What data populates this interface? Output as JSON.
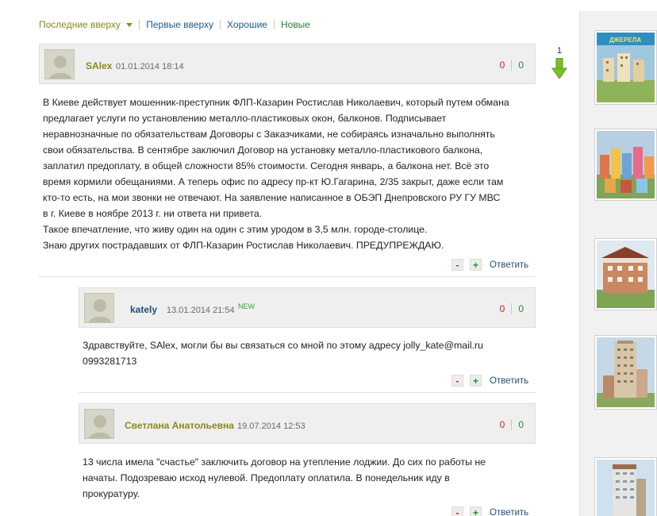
{
  "sort": {
    "options": [
      "Последние вверху",
      "Первые вверху",
      "Хорошие",
      "Новые"
    ]
  },
  "pagination": {
    "current_page": "1"
  },
  "comments": [
    {
      "author": "SAlex",
      "date": "01.01.2014 18:14",
      "votes_negative": "0",
      "votes_positive": "0",
      "lines": [
        "В Киеве действует мошенник-преступник ФЛП-Казарин Ростислав Николаевич, который путем обмана",
        "предлагает услуги по установлению металло-пластиковых окон, балконов. Подписывает",
        "неравнозначные по обязательствам Договоры с Заказчиками, не собираясь изначально выполнять",
        "свои обязательства. В сентябре заключил Договор на установку металло-пластикового балкона,",
        "заплатил предоплату, в общей сложности 85% стоимости. Сегодня январь, а балкона нет. Всё это",
        "время кормили обещаниями. А теперь офис по адресу пр-кт Ю.Гагарина, 2/35 закрыт, даже если там",
        "кто-то есть, на мои звонки не отвечают. На заявление написанное в ОБЭП Днепровского РУ ГУ МВС",
        "в г. Киеве в ноябре 2013 г. ни ответа ни привета.",
        "Такое впечатление, что живу один на один с этим уродом в 3,5 млн. городе-столице.",
        "Знаю других пострадавших от ФЛП-Казарин Ростислав Николаевич. ПРЕДУПРЕЖДАЮ."
      ],
      "minus_label": "-",
      "plus_label": "+",
      "reply_label": "Ответить"
    },
    {
      "author": "kately",
      "date": "13.01.2014 21:54",
      "badge": "NEW",
      "votes_negative": "0",
      "votes_positive": "0",
      "lines": [
        "Здравствуйте, SAlex, могли бы вы связаться со мной по этому адресу jolly_kate@mail.ru",
        "0993281713"
      ],
      "minus_label": "-",
      "plus_label": "+",
      "reply_label": "Ответить"
    },
    {
      "author": "Светлана Анатольевна",
      "date": "19.07.2014 12:53",
      "votes_negative": "0",
      "votes_positive": "0",
      "lines": [
        "13 числа имела \"счастье\" заключить договор на утепление лоджии. До сих по работы не",
        "начаты. Подозреваю исход нулевой. Предоплату оплатила. В понедельник иду в",
        "прокуратуру."
      ],
      "minus_label": "-",
      "plus_label": "+",
      "reply_label": "Ответить"
    }
  ],
  "sidebar": {
    "ads": [
      {
        "title": "ДЖЕРЕЛА"
      },
      {
        "title": ""
      },
      {
        "title": ""
      },
      {
        "title": ""
      },
      {
        "title": ""
      }
    ]
  },
  "colors": {
    "accent_olive": "#8a8a1a",
    "link_blue": "#1f4f7a",
    "vote_negative": "#d22020",
    "vote_positive": "#2a8a2a",
    "new_badge": "#35a535",
    "arrow_green": "#7cbf2a"
  }
}
